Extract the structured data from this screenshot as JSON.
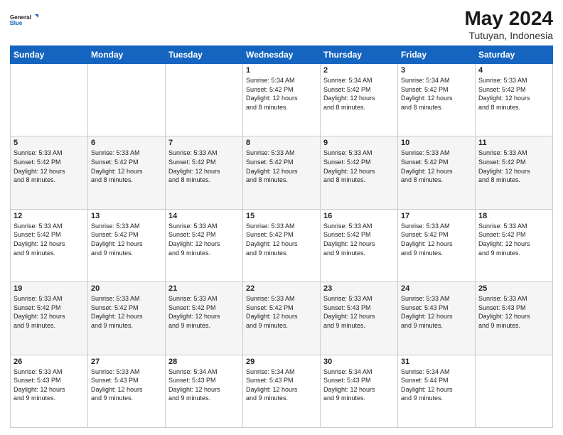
{
  "header": {
    "logo_general": "General",
    "logo_blue": "Blue",
    "month_year": "May 2024",
    "location": "Tutuyan, Indonesia"
  },
  "days_of_week": [
    "Sunday",
    "Monday",
    "Tuesday",
    "Wednesday",
    "Thursday",
    "Friday",
    "Saturday"
  ],
  "weeks": [
    [
      {
        "day": "",
        "info": ""
      },
      {
        "day": "",
        "info": ""
      },
      {
        "day": "",
        "info": ""
      },
      {
        "day": "1",
        "info": "Sunrise: 5:34 AM\nSunset: 5:42 PM\nDaylight: 12 hours\nand 8 minutes."
      },
      {
        "day": "2",
        "info": "Sunrise: 5:34 AM\nSunset: 5:42 PM\nDaylight: 12 hours\nand 8 minutes."
      },
      {
        "day": "3",
        "info": "Sunrise: 5:34 AM\nSunset: 5:42 PM\nDaylight: 12 hours\nand 8 minutes."
      },
      {
        "day": "4",
        "info": "Sunrise: 5:33 AM\nSunset: 5:42 PM\nDaylight: 12 hours\nand 8 minutes."
      }
    ],
    [
      {
        "day": "5",
        "info": "Sunrise: 5:33 AM\nSunset: 5:42 PM\nDaylight: 12 hours\nand 8 minutes."
      },
      {
        "day": "6",
        "info": "Sunrise: 5:33 AM\nSunset: 5:42 PM\nDaylight: 12 hours\nand 8 minutes."
      },
      {
        "day": "7",
        "info": "Sunrise: 5:33 AM\nSunset: 5:42 PM\nDaylight: 12 hours\nand 8 minutes."
      },
      {
        "day": "8",
        "info": "Sunrise: 5:33 AM\nSunset: 5:42 PM\nDaylight: 12 hours\nand 8 minutes."
      },
      {
        "day": "9",
        "info": "Sunrise: 5:33 AM\nSunset: 5:42 PM\nDaylight: 12 hours\nand 8 minutes."
      },
      {
        "day": "10",
        "info": "Sunrise: 5:33 AM\nSunset: 5:42 PM\nDaylight: 12 hours\nand 8 minutes."
      },
      {
        "day": "11",
        "info": "Sunrise: 5:33 AM\nSunset: 5:42 PM\nDaylight: 12 hours\nand 8 minutes."
      }
    ],
    [
      {
        "day": "12",
        "info": "Sunrise: 5:33 AM\nSunset: 5:42 PM\nDaylight: 12 hours\nand 9 minutes."
      },
      {
        "day": "13",
        "info": "Sunrise: 5:33 AM\nSunset: 5:42 PM\nDaylight: 12 hours\nand 9 minutes."
      },
      {
        "day": "14",
        "info": "Sunrise: 5:33 AM\nSunset: 5:42 PM\nDaylight: 12 hours\nand 9 minutes."
      },
      {
        "day": "15",
        "info": "Sunrise: 5:33 AM\nSunset: 5:42 PM\nDaylight: 12 hours\nand 9 minutes."
      },
      {
        "day": "16",
        "info": "Sunrise: 5:33 AM\nSunset: 5:42 PM\nDaylight: 12 hours\nand 9 minutes."
      },
      {
        "day": "17",
        "info": "Sunrise: 5:33 AM\nSunset: 5:42 PM\nDaylight: 12 hours\nand 9 minutes."
      },
      {
        "day": "18",
        "info": "Sunrise: 5:33 AM\nSunset: 5:42 PM\nDaylight: 12 hours\nand 9 minutes."
      }
    ],
    [
      {
        "day": "19",
        "info": "Sunrise: 5:33 AM\nSunset: 5:42 PM\nDaylight: 12 hours\nand 9 minutes."
      },
      {
        "day": "20",
        "info": "Sunrise: 5:33 AM\nSunset: 5:42 PM\nDaylight: 12 hours\nand 9 minutes."
      },
      {
        "day": "21",
        "info": "Sunrise: 5:33 AM\nSunset: 5:42 PM\nDaylight: 12 hours\nand 9 minutes."
      },
      {
        "day": "22",
        "info": "Sunrise: 5:33 AM\nSunset: 5:42 PM\nDaylight: 12 hours\nand 9 minutes."
      },
      {
        "day": "23",
        "info": "Sunrise: 5:33 AM\nSunset: 5:43 PM\nDaylight: 12 hours\nand 9 minutes."
      },
      {
        "day": "24",
        "info": "Sunrise: 5:33 AM\nSunset: 5:43 PM\nDaylight: 12 hours\nand 9 minutes."
      },
      {
        "day": "25",
        "info": "Sunrise: 5:33 AM\nSunset: 5:43 PM\nDaylight: 12 hours\nand 9 minutes."
      }
    ],
    [
      {
        "day": "26",
        "info": "Sunrise: 5:33 AM\nSunset: 5:43 PM\nDaylight: 12 hours\nand 9 minutes."
      },
      {
        "day": "27",
        "info": "Sunrise: 5:33 AM\nSunset: 5:43 PM\nDaylight: 12 hours\nand 9 minutes."
      },
      {
        "day": "28",
        "info": "Sunrise: 5:34 AM\nSunset: 5:43 PM\nDaylight: 12 hours\nand 9 minutes."
      },
      {
        "day": "29",
        "info": "Sunrise: 5:34 AM\nSunset: 5:43 PM\nDaylight: 12 hours\nand 9 minutes."
      },
      {
        "day": "30",
        "info": "Sunrise: 5:34 AM\nSunset: 5:43 PM\nDaylight: 12 hours\nand 9 minutes."
      },
      {
        "day": "31",
        "info": "Sunrise: 5:34 AM\nSunset: 5:44 PM\nDaylight: 12 hours\nand 9 minutes."
      },
      {
        "day": "",
        "info": ""
      }
    ]
  ]
}
